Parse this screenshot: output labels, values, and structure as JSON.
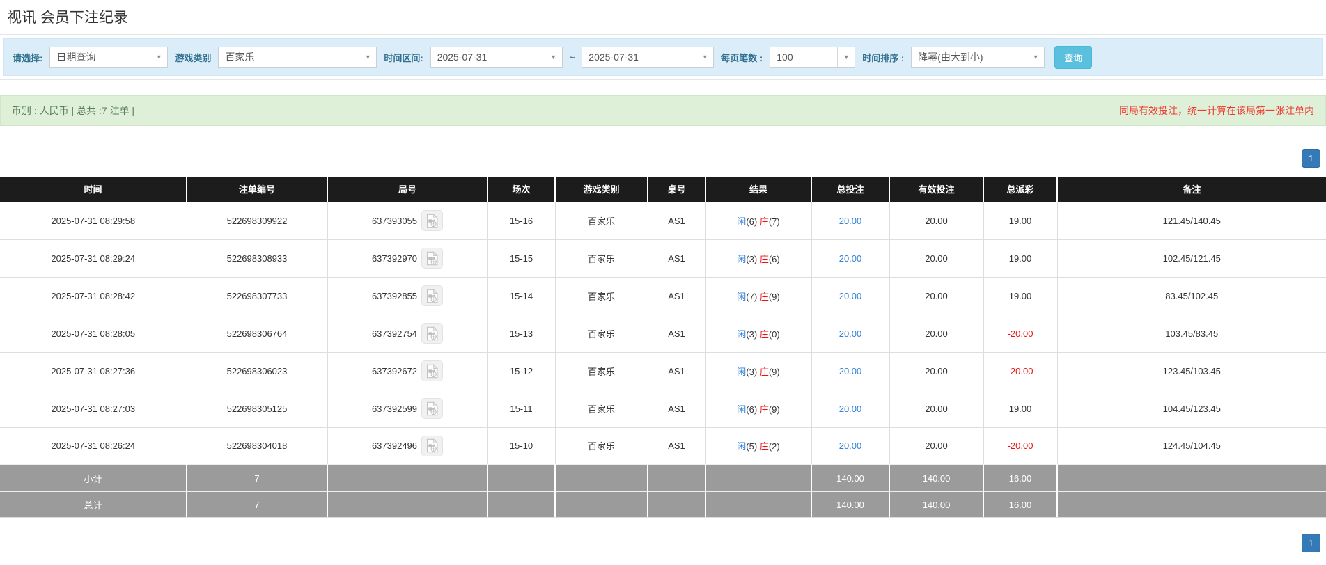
{
  "title": "视讯 会员下注纪录",
  "filters": {
    "query_type": {
      "label": "请选择:",
      "value": "日期查询"
    },
    "game_category": {
      "label": "游戏类别",
      "value": "百家乐"
    },
    "time_range": {
      "label": "时间区间:",
      "from": "2025-07-31",
      "separator": "~",
      "to": "2025-07-31"
    },
    "page_size": {
      "label": "每页笔数 :",
      "value": "100"
    },
    "time_sort": {
      "label": "时间排序 :",
      "value": "降幂(由大到小)"
    },
    "search_button": "查询"
  },
  "summary": {
    "left": "币别 : 人民币 | 总共 :7 注单 |",
    "right": "同局有效投注，统一计算在该局第一张注单内"
  },
  "pagination": {
    "page": "1"
  },
  "table": {
    "headers": [
      "时间",
      "注单编号",
      "局号",
      "场次",
      "游戏类别",
      "桌号",
      "结果",
      "总投注",
      "有效投注",
      "总派彩",
      "备注"
    ],
    "rows": [
      {
        "time": "2025-07-31 08:29:58",
        "bet_no": "522698309922",
        "round_no": "637393055",
        "session": "15-16",
        "game": "百家乐",
        "table_no": "AS1",
        "player": "闲",
        "player_score": "(6)",
        "banker": "庄",
        "banker_score": "(7)",
        "total_bet": "20.00",
        "valid_bet": "20.00",
        "payout": "19.00",
        "remark": "121.45/140.45"
      },
      {
        "time": "2025-07-31 08:29:24",
        "bet_no": "522698308933",
        "round_no": "637392970",
        "session": "15-15",
        "game": "百家乐",
        "table_no": "AS1",
        "player": "闲",
        "player_score": "(3)",
        "banker": "庄",
        "banker_score": "(6)",
        "total_bet": "20.00",
        "valid_bet": "20.00",
        "payout": "19.00",
        "remark": "102.45/121.45"
      },
      {
        "time": "2025-07-31 08:28:42",
        "bet_no": "522698307733",
        "round_no": "637392855",
        "session": "15-14",
        "game": "百家乐",
        "table_no": "AS1",
        "player": "闲",
        "player_score": "(7)",
        "banker": "庄",
        "banker_score": "(9)",
        "total_bet": "20.00",
        "valid_bet": "20.00",
        "payout": "19.00",
        "remark": "83.45/102.45"
      },
      {
        "time": "2025-07-31 08:28:05",
        "bet_no": "522698306764",
        "round_no": "637392754",
        "session": "15-13",
        "game": "百家乐",
        "table_no": "AS1",
        "player": "闲",
        "player_score": "(3)",
        "banker": "庄",
        "banker_score": "(0)",
        "total_bet": "20.00",
        "valid_bet": "20.00",
        "payout": "-20.00",
        "remark": "103.45/83.45"
      },
      {
        "time": "2025-07-31 08:27:36",
        "bet_no": "522698306023",
        "round_no": "637392672",
        "session": "15-12",
        "game": "百家乐",
        "table_no": "AS1",
        "player": "闲",
        "player_score": "(3)",
        "banker": "庄",
        "banker_score": "(9)",
        "total_bet": "20.00",
        "valid_bet": "20.00",
        "payout": "-20.00",
        "remark": "123.45/103.45"
      },
      {
        "time": "2025-07-31 08:27:03",
        "bet_no": "522698305125",
        "round_no": "637392599",
        "session": "15-11",
        "game": "百家乐",
        "table_no": "AS1",
        "player": "闲",
        "player_score": "(6)",
        "banker": "庄",
        "banker_score": "(9)",
        "total_bet": "20.00",
        "valid_bet": "20.00",
        "payout": "19.00",
        "remark": "104.45/123.45"
      },
      {
        "time": "2025-07-31 08:26:24",
        "bet_no": "522698304018",
        "round_no": "637392496",
        "session": "15-10",
        "game": "百家乐",
        "table_no": "AS1",
        "player": "闲",
        "player_score": "(5)",
        "banker": "庄",
        "banker_score": "(2)",
        "total_bet": "20.00",
        "valid_bet": "20.00",
        "payout": "-20.00",
        "remark": "124.45/104.45"
      }
    ],
    "subtotal": {
      "label": "小计",
      "count": "7",
      "total_bet": "140.00",
      "valid_bet": "140.00",
      "payout": "16.00"
    },
    "grand_total": {
      "label": "总计",
      "count": "7",
      "total_bet": "140.00",
      "valid_bet": "140.00",
      "payout": "16.00"
    }
  },
  "colors": {
    "header_bg": "#1c1c1c",
    "footer_gray": "#9b9b9b",
    "panel_blue": "#daedf8",
    "panel_green": "#dff0d8",
    "link_blue": "#2e7fd9",
    "player_blue": "#2e7fd9",
    "banker_red": "#ee1111",
    "negative_red": "#ee1111",
    "alert_red": "#f03b30",
    "search_button_teal": "#5bc0de",
    "pager_blue": "#337ab7"
  }
}
